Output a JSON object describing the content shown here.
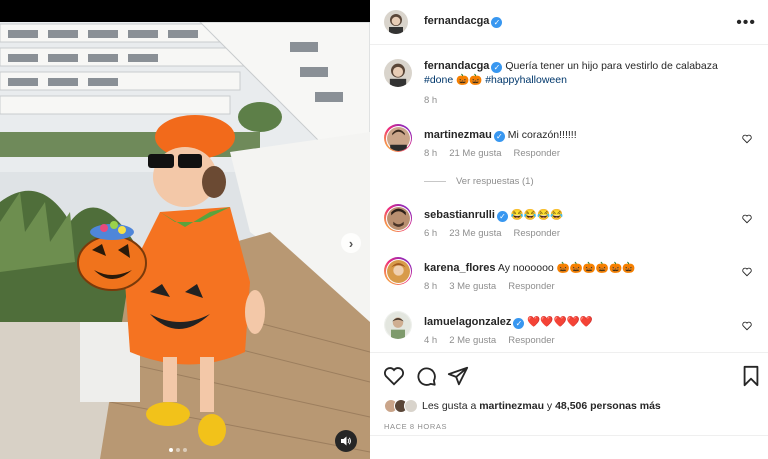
{
  "post": {
    "author": "fernandacga",
    "caption_text": "Quería tener un hijo para vestirlo de calabaza",
    "hashtag_done": "#done",
    "emoji_pair": "🎃🎃",
    "hashtag_halloween": "#happyhalloween",
    "caption_time": "8 h",
    "more_label": "•••",
    "carousel": {
      "slides": 3,
      "active_index": 0
    }
  },
  "comments": [
    {
      "user": "martinezmau",
      "verified": true,
      "text": "Mi corazón!!!!!!",
      "time": "8 h",
      "likes": "21 Me gusta",
      "reply": "Responder"
    },
    {
      "user": "sebastianrulli",
      "verified": true,
      "text": "😂😂😂😂",
      "time": "6 h",
      "likes": "23 Me gusta",
      "reply": "Responder"
    },
    {
      "user": "karena_flores",
      "verified": false,
      "text": "Ay noooooo 🎃🎃🎃🎃🎃🎃",
      "time": "8 h",
      "likes": "3 Me gusta",
      "reply": "Responder"
    },
    {
      "user": "lamuelagonzalez",
      "verified": true,
      "text": "❤️❤️❤️❤️❤️",
      "time": "4 h",
      "likes": "2 Me gusta",
      "reply": "Responder"
    }
  ],
  "view_replies": "Ver respuestas (1)",
  "likes_summary": {
    "prefix": "Les gusta a ",
    "user": "martinezmau",
    "middle": " y ",
    "count": "48,506 personas más"
  },
  "time_ago": "HACE 8 HORAS",
  "colors": {
    "link": "#00376b",
    "verified": "#3897f0",
    "heart": "#ed4956",
    "meta": "#8e8e8e"
  }
}
